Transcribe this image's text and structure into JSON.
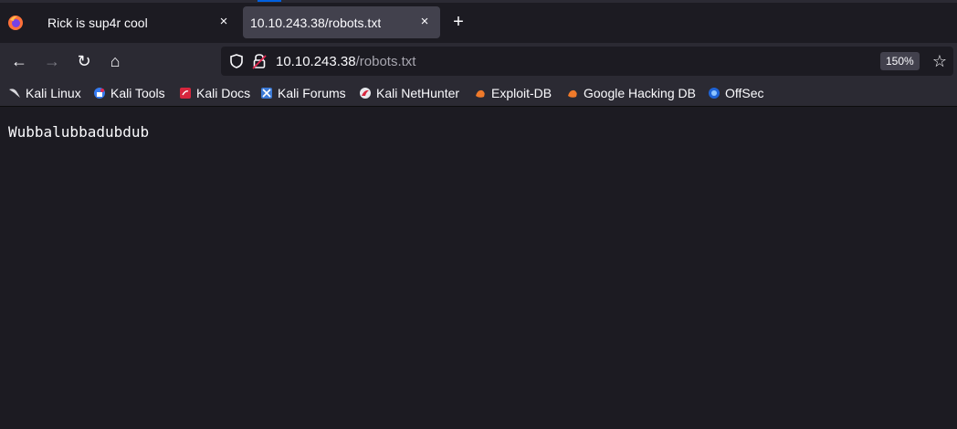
{
  "browser": {
    "tabs": [
      {
        "title": "Rick is sup4r cool",
        "close": "×"
      },
      {
        "title": "10.10.243.38/robots.txt",
        "close": "×"
      }
    ],
    "new_tab": "+",
    "nav": {
      "back": "←",
      "forward": "→",
      "reload": "↻",
      "home": "⌂"
    },
    "url": {
      "host": "10.10.243.38",
      "path": "/robots.txt"
    },
    "zoom": "150%",
    "star": "☆"
  },
  "bookmarks": [
    {
      "label": "Kali Linux",
      "icon": "kali-dragon-icon"
    },
    {
      "label": "Kali Tools",
      "icon": "kali-tools-icon"
    },
    {
      "label": "Kali Docs",
      "icon": "kali-docs-icon"
    },
    {
      "label": "Kali Forums",
      "icon": "kali-forums-icon"
    },
    {
      "label": "Kali NetHunter",
      "icon": "kali-nethunter-icon"
    },
    {
      "label": "Exploit-DB",
      "icon": "exploit-db-icon"
    },
    {
      "label": "Google Hacking DB",
      "icon": "google-hacking-db-icon"
    },
    {
      "label": "OffSec",
      "icon": "offsec-icon"
    }
  ],
  "page": {
    "text": "Wubbalubbadubdub"
  }
}
